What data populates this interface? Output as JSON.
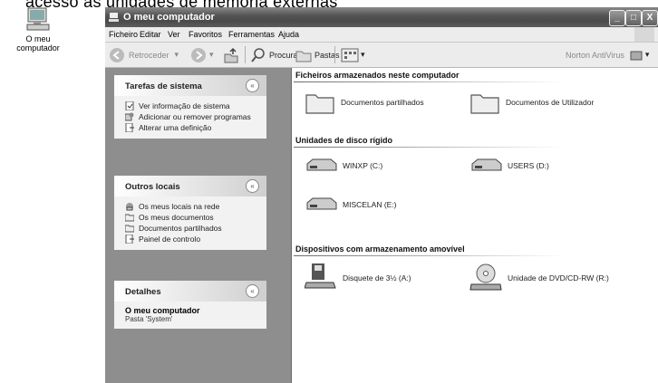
{
  "top_caption": "acesso às unidades de memória externas",
  "desktop_icon": {
    "label_line1": "O meu",
    "label_line2": "computador",
    "icon": "my-computer-icon"
  },
  "window": {
    "title": "O meu computador",
    "buttons": {
      "minimize": "_",
      "maximize": "□",
      "close": "X"
    }
  },
  "menu": [
    "Ficheiro",
    "Editar",
    "Ver",
    "Favoritos",
    "Ferramentas",
    "Ajuda"
  ],
  "toolbar": {
    "back": "Retroceder",
    "search": "Procurar",
    "folders": "Pastas",
    "antivirus": "Norton AntiVirus"
  },
  "panels": {
    "system_tasks": {
      "title": "Tarefas de sistema",
      "items": [
        "Ver informação de sistema",
        "Adicionar ou remover programas",
        "Alterar uma definição"
      ]
    },
    "other_places": {
      "title": "Outros locais",
      "items": [
        "Os meus locais na rede",
        "Os meus documentos",
        "Documentos partilhados",
        "Painel de controlo"
      ]
    },
    "details": {
      "title": "Detalhes",
      "name": "O meu computador",
      "subtitle": "Pasta 'System'"
    }
  },
  "content": {
    "sections": [
      {
        "title": "Ficheiros armazenados neste computador",
        "items": [
          "Documentos partilhados",
          "Documentos de Utilizador"
        ]
      },
      {
        "title": "Unidades de disco rígido",
        "items": [
          "WINXP (C:)",
          "USERS (D:)",
          "MISCELAN (E:)"
        ]
      },
      {
        "title": "Dispositivos com armazenamento amovível",
        "items": [
          "Disquete de 3½ (A:)",
          "Unidade de DVD/CD-RW (R:)"
        ]
      }
    ]
  }
}
